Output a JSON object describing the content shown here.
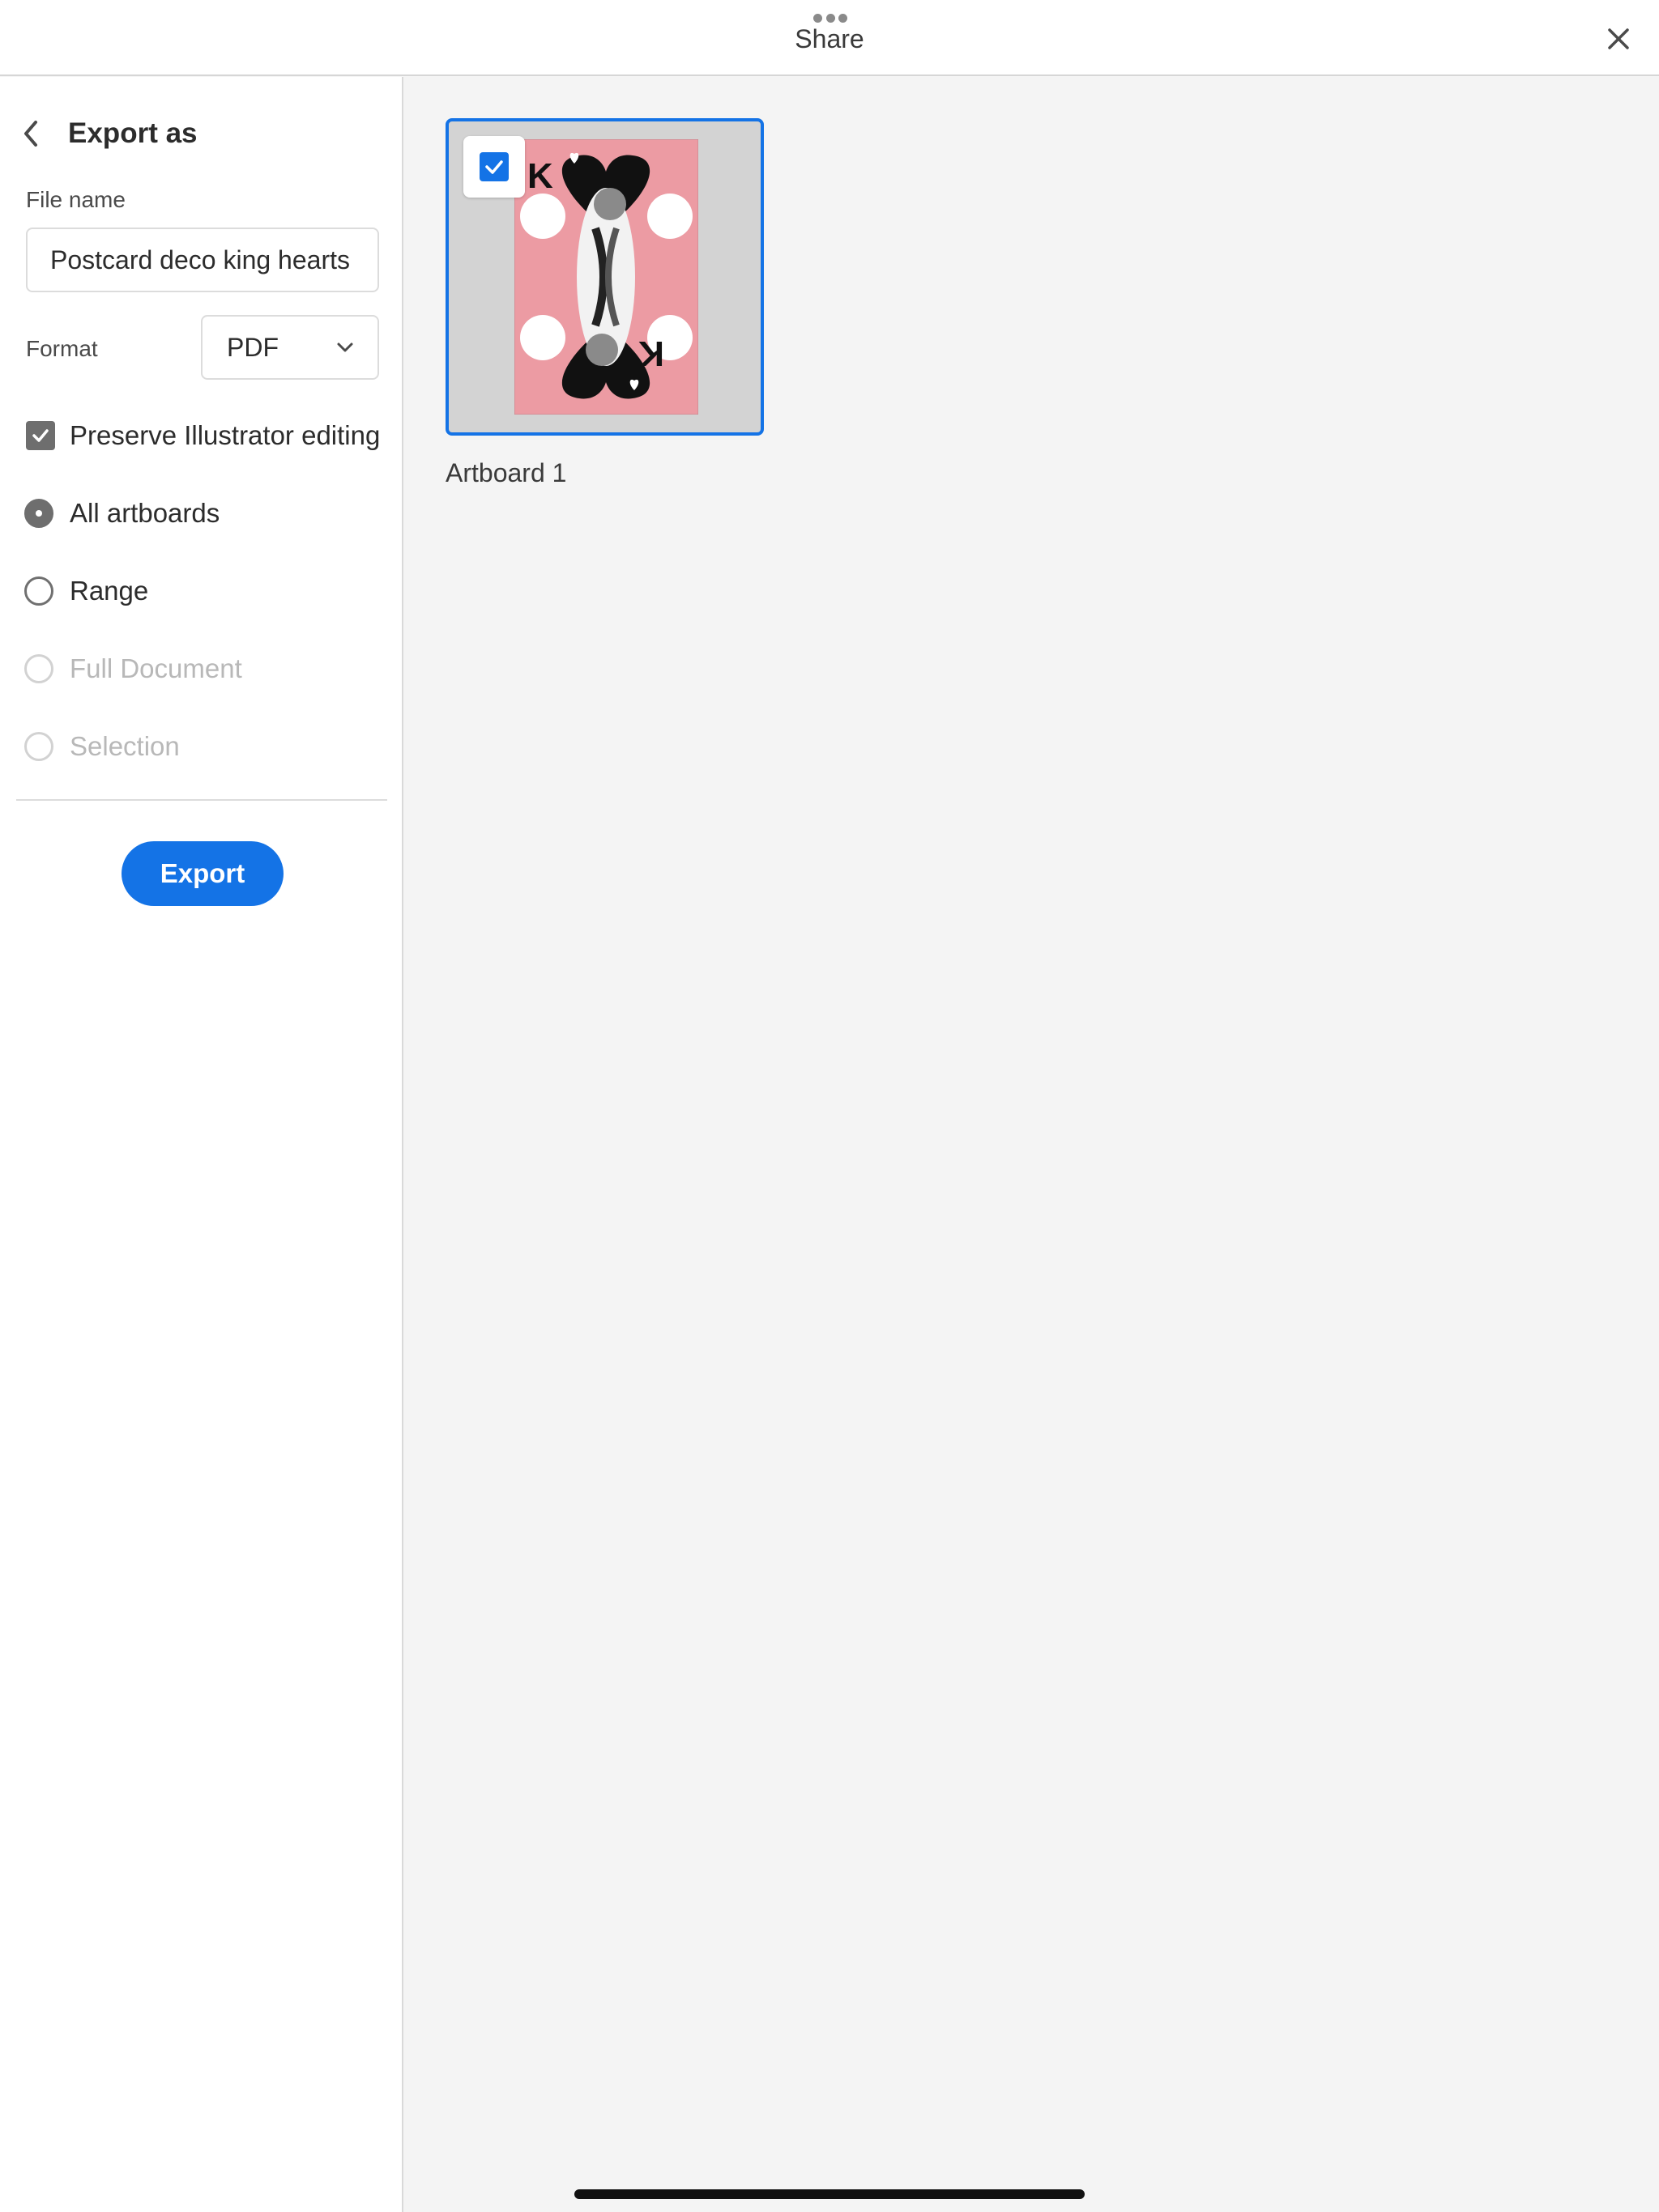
{
  "header": {
    "title": "Share"
  },
  "sidebar": {
    "back_title": "Export as",
    "file_name_label": "File name",
    "file_name_value": "Postcard deco king hearts",
    "format_label": "Format",
    "format_value": "PDF",
    "preserve_label": "Preserve Illustrator editing",
    "preserve_checked": true,
    "options": [
      {
        "label": "All artboards",
        "selected": true,
        "disabled": false
      },
      {
        "label": "Range",
        "selected": false,
        "disabled": false
      },
      {
        "label": "Full Document",
        "selected": false,
        "disabled": true
      },
      {
        "label": "Selection",
        "selected": false,
        "disabled": true
      }
    ],
    "export_label": "Export"
  },
  "main": {
    "artboards": [
      {
        "label": "Artboard 1",
        "selected": true
      }
    ]
  },
  "colors": {
    "accent": "#1473e6",
    "thumb_pink": "#ec9ba3",
    "panel_bg": "#f4f4f4"
  }
}
